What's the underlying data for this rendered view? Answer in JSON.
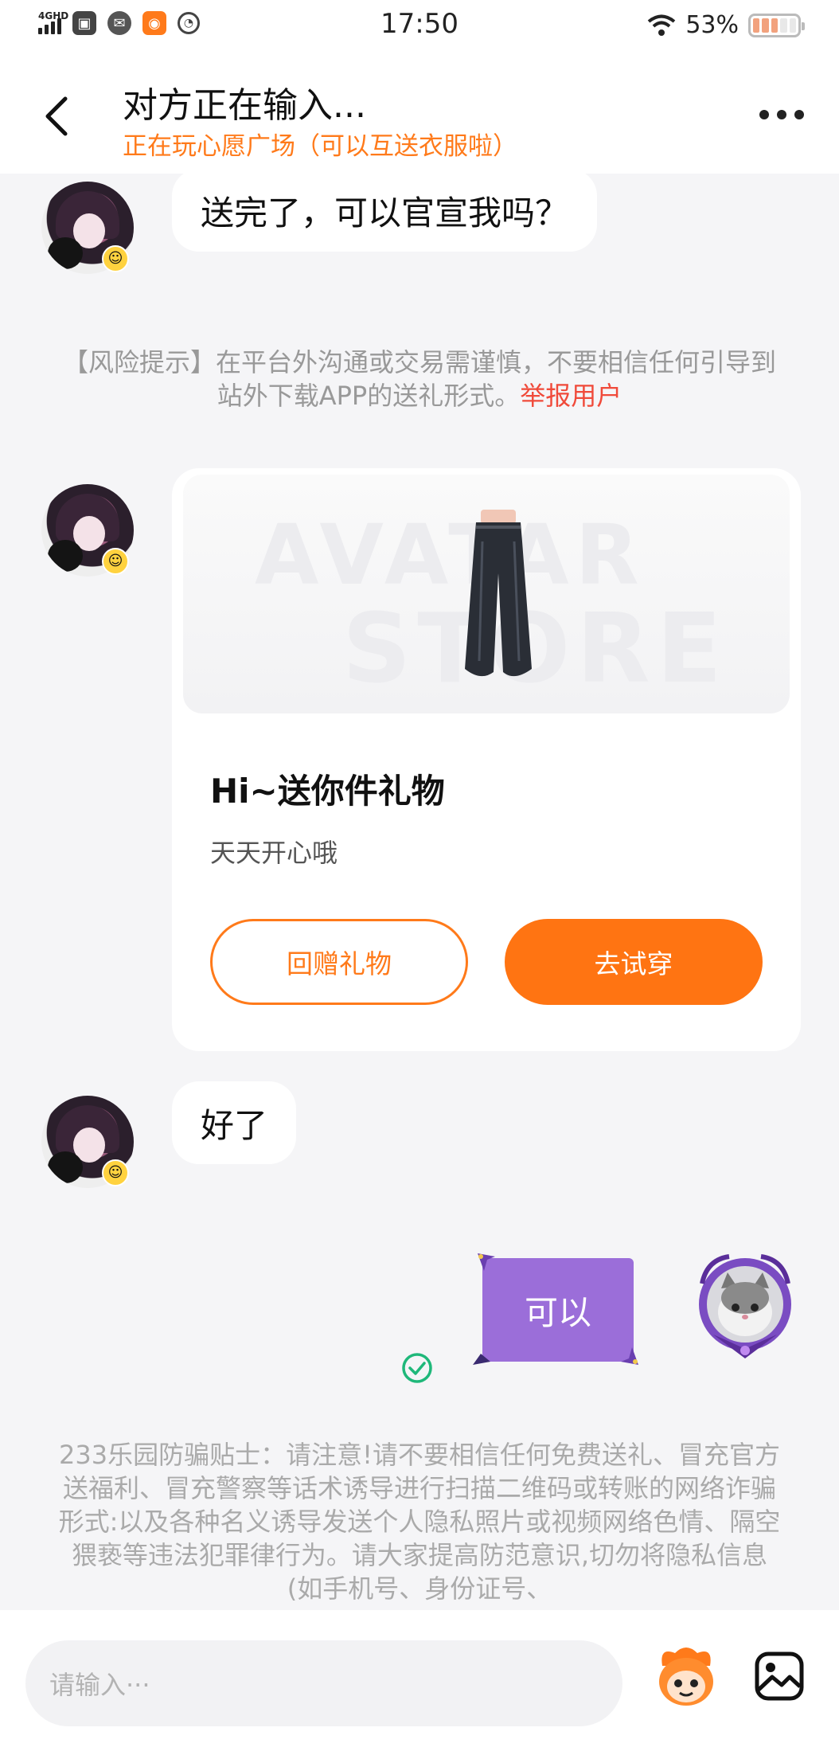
{
  "status_bar": {
    "network": "4GHD",
    "time": "17:50",
    "battery_percent": "53%",
    "icons": [
      "signal-icon",
      "app-icon",
      "wechat-icon",
      "app-icon-orange",
      "speed-icon",
      "wifi-icon",
      "battery-icon"
    ]
  },
  "header": {
    "title": "对方正在输入...",
    "subtitle": "正在玩心愿广场（可以互送衣服啦）",
    "accent_color": "#ff7a1a"
  },
  "messages": {
    "msg1": "送完了，可以官宣我吗？",
    "risk_notice": "【风险提示】在平台外沟通或交易需谨慎，不要相信任何引导到站外下载APP的送礼形式。",
    "report_link": "举报用户",
    "gift_card": {
      "watermark_line1": "AVATAR",
      "watermark_line2": "STORE",
      "title": "Hi~送你件礼物",
      "subtitle": "天天开心哦",
      "return_gift_button": "回赠礼物",
      "try_on_button": "去试穿"
    },
    "msg2": "好了",
    "my_msg": "可以",
    "fraud_notice": "233乐园防骗贴士：请注意!请不要相信任何免费送礼、冒充官方送福利、冒充警察等话术诱导进行扫描二维码或转账的网络诈骗形式:以及各种名义诱导发送个人隐私照片或视频网络色情、隔空猥亵等违法犯罪律行为。请大家提高防范意识,切勿将隐私信息(如手机号、身份证号、"
  },
  "input": {
    "placeholder": "请输入···"
  }
}
